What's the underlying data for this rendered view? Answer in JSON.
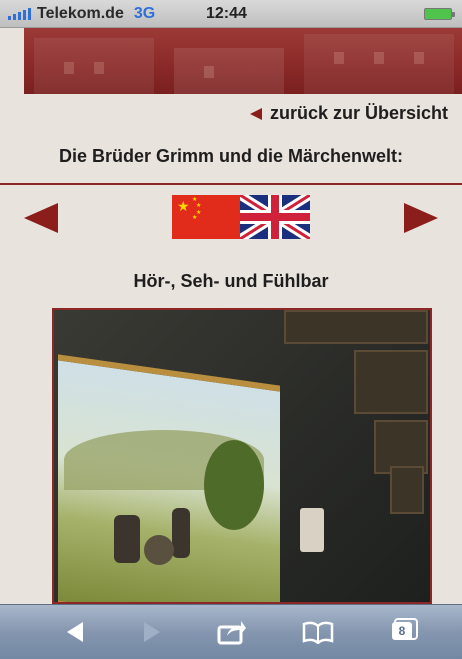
{
  "status_bar": {
    "carrier": "Telekom.de",
    "network": "3G",
    "time": "12:44",
    "battery_color": "#4fc34b"
  },
  "page": {
    "back_link": "zurück zur Übersicht",
    "title": "Die Brüder Grimm und die Märchenwelt:",
    "subtitle": "Hör-, Seh- und Fühlbar",
    "accent_color": "#8b1d1a"
  },
  "language_flags": [
    "flag-china-icon",
    "flag-uk-icon"
  ],
  "toolbar": {
    "icons": [
      "back-arrow-icon",
      "forward-arrow-icon",
      "share-icon",
      "bookmarks-icon",
      "tabs-icon"
    ],
    "tab_count": "8"
  }
}
